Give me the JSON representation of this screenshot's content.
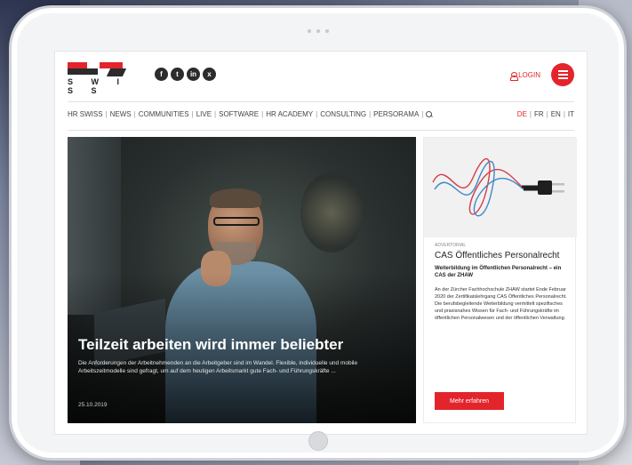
{
  "site": {
    "logo_text": "S W I S S",
    "social_icons": [
      "f",
      "t",
      "in",
      "x"
    ],
    "login_label": "LOGIN"
  },
  "nav": {
    "items": [
      "HR SWISS",
      "NEWS",
      "COMMUNITIES",
      "LIVE",
      "SOFTWARE",
      "HR ACADEMY",
      "CONSULTING",
      "PERSORAMA"
    ],
    "languages": [
      "DE",
      "FR",
      "EN",
      "IT"
    ],
    "active_language": "DE"
  },
  "hero": {
    "title": "Teilzeit arbeiten wird immer beliebter",
    "excerpt": "Die Anforderungen der Arbeitnehmenden an die Arbeitgeber sind im Wandel. Flexible, individuelle und mobile Arbeitszeitmodelle sind gefragt, um auf dem heutigen Arbeitsmarkt gute Fach- und Führungskräfte ...",
    "date": "25.10.2019"
  },
  "ad": {
    "label": "ADVERTORIAL",
    "title": "CAS Öffentliches Personalrecht",
    "subtitle": "Weiterbildung im Öffentlichen Personalrecht – ein CAS der ZHAW",
    "text": "An der Zürcher Fachhochschule ZHAW startet Ende Februar 2020 der Zertifikatslehrgang CAS Öffentliches Personalrecht. Die berufsbegleitende Weiterbildung vermittelt spezifisches und praxisnahes Wissen für Fach- und Führungskräfte im öffentlichen Personalwesen und der öffentlichen Verwaltung.",
    "button_label": "Mehr erfahren"
  },
  "colors": {
    "accent": "#e3242b",
    "text": "#222222"
  }
}
